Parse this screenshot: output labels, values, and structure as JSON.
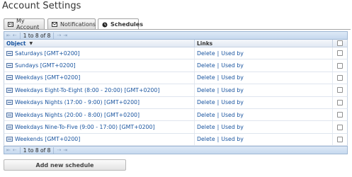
{
  "page": {
    "title": "Account Settings"
  },
  "tabs": [
    {
      "label": "My Account",
      "icon": "account-card-icon"
    },
    {
      "label": "Notifications",
      "icon": "envelope-icon"
    },
    {
      "label": "Schedules",
      "icon": "clock-icon",
      "active": true
    }
  ],
  "pager": {
    "text": "1 to 8 of 8"
  },
  "table": {
    "headers": {
      "object": "Object",
      "links": "Links"
    },
    "sort": "descending",
    "rows": [
      {
        "object": "Saturdays [GMT+0200]",
        "delete": "Delete",
        "used_by": "Used by"
      },
      {
        "object": "Sundays [GMT+0200]",
        "delete": "Delete",
        "used_by": "Used by"
      },
      {
        "object": "Weekdays [GMT+0200]",
        "delete": "Delete",
        "used_by": "Used by"
      },
      {
        "object": "Weekdays Eight-To-Eight (8:00 - 20:00) [GMT+0200]",
        "delete": "Delete",
        "used_by": "Used by"
      },
      {
        "object": "Weekdays Nights (17:00 - 9:00) [GMT+0200]",
        "delete": "Delete",
        "used_by": "Used by"
      },
      {
        "object": "Weekdays Nights (20:00 - 8:00) [GMT+0200]",
        "delete": "Delete",
        "used_by": "Used by"
      },
      {
        "object": "Weekdays Nine-To-Five (9:00 - 17:00) [GMT+0200]",
        "delete": "Delete",
        "used_by": "Used by"
      },
      {
        "object": "Weekends [GMT+0200]",
        "delete": "Delete",
        "used_by": "Used by"
      }
    ]
  },
  "actions": {
    "add_label": "Add new schedule"
  },
  "colors": {
    "link": "#1a55a0",
    "pager_bg": "#c6d9ef",
    "header_bg": "#e2e9f3"
  }
}
